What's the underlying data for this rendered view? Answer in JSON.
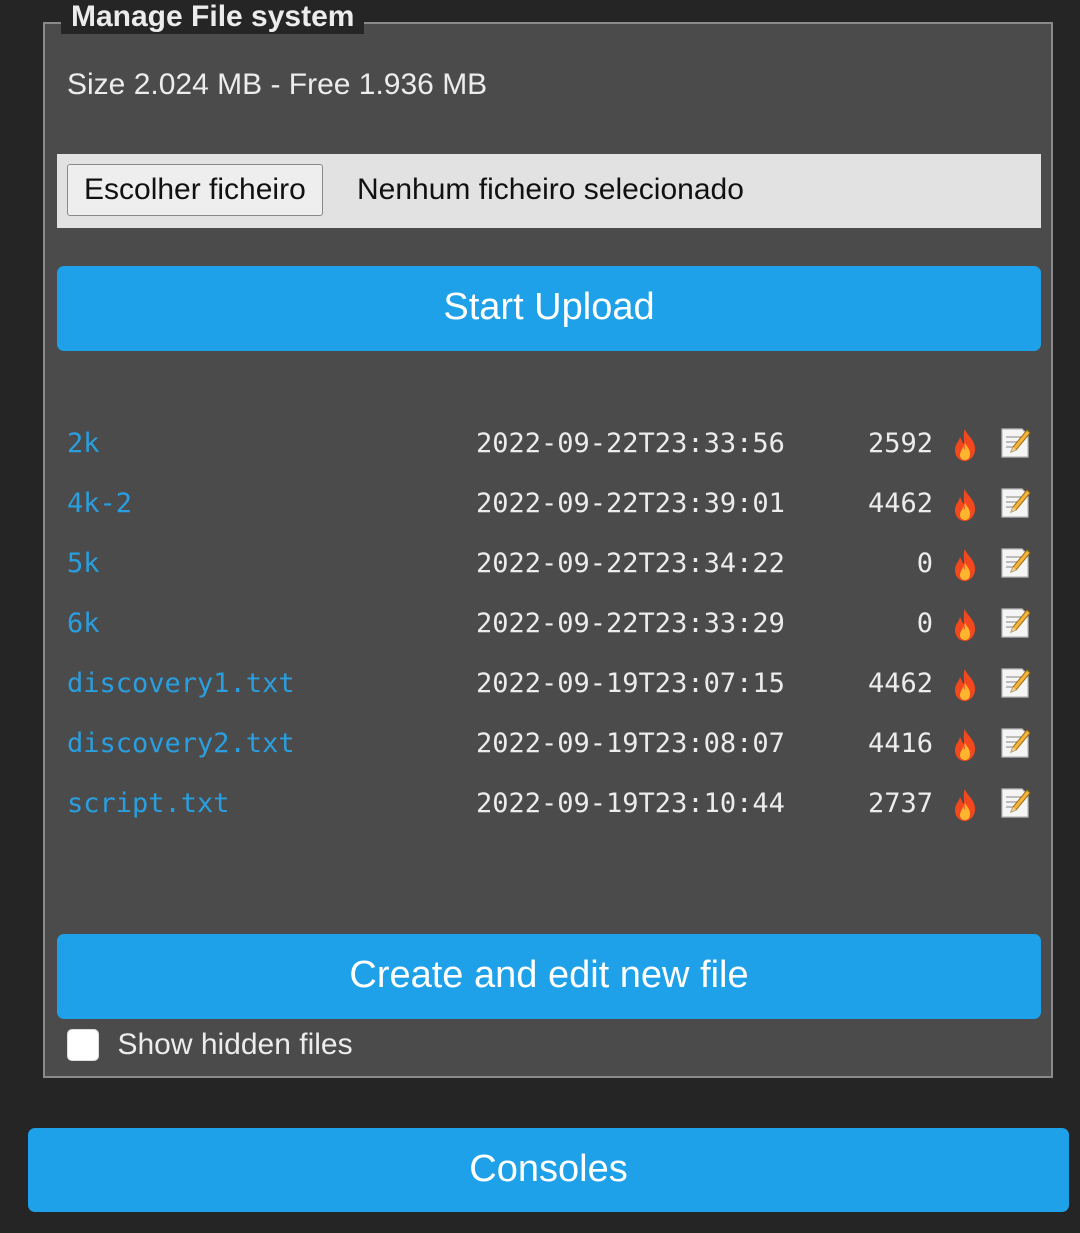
{
  "panel": {
    "title": "Manage File system",
    "size_text": "Size 2.024 MB - Free 1.936 MB"
  },
  "file_input": {
    "button_label": "Escolher ficheiro",
    "status": "Nenhum ficheiro selecionado"
  },
  "buttons": {
    "upload": "Start Upload",
    "create": "Create and edit new file",
    "consoles": "Consoles"
  },
  "files": [
    {
      "name": "2k",
      "date": "2022-09-22T23:33:56",
      "size": "2592"
    },
    {
      "name": "4k-2",
      "date": "2022-09-22T23:39:01",
      "size": "4462"
    },
    {
      "name": "5k",
      "date": "2022-09-22T23:34:22",
      "size": "0"
    },
    {
      "name": "6k",
      "date": "2022-09-22T23:33:29",
      "size": "0"
    },
    {
      "name": "discovery1.txt",
      "date": "2022-09-19T23:07:15",
      "size": "4462"
    },
    {
      "name": "discovery2.txt",
      "date": "2022-09-19T23:08:07",
      "size": "4416"
    },
    {
      "name": "script.txt",
      "date": "2022-09-19T23:10:44",
      "size": "2737"
    }
  ],
  "file_row_icons": {
    "delete": "fire-icon",
    "edit": "memo-icon"
  },
  "show_hidden": {
    "label": "Show hidden files",
    "checked": false
  },
  "colors": {
    "accent": "#1ea1e8",
    "link": "#2a9fe0",
    "panel_bg": "#4b4b4b",
    "page_bg": "#252525"
  }
}
